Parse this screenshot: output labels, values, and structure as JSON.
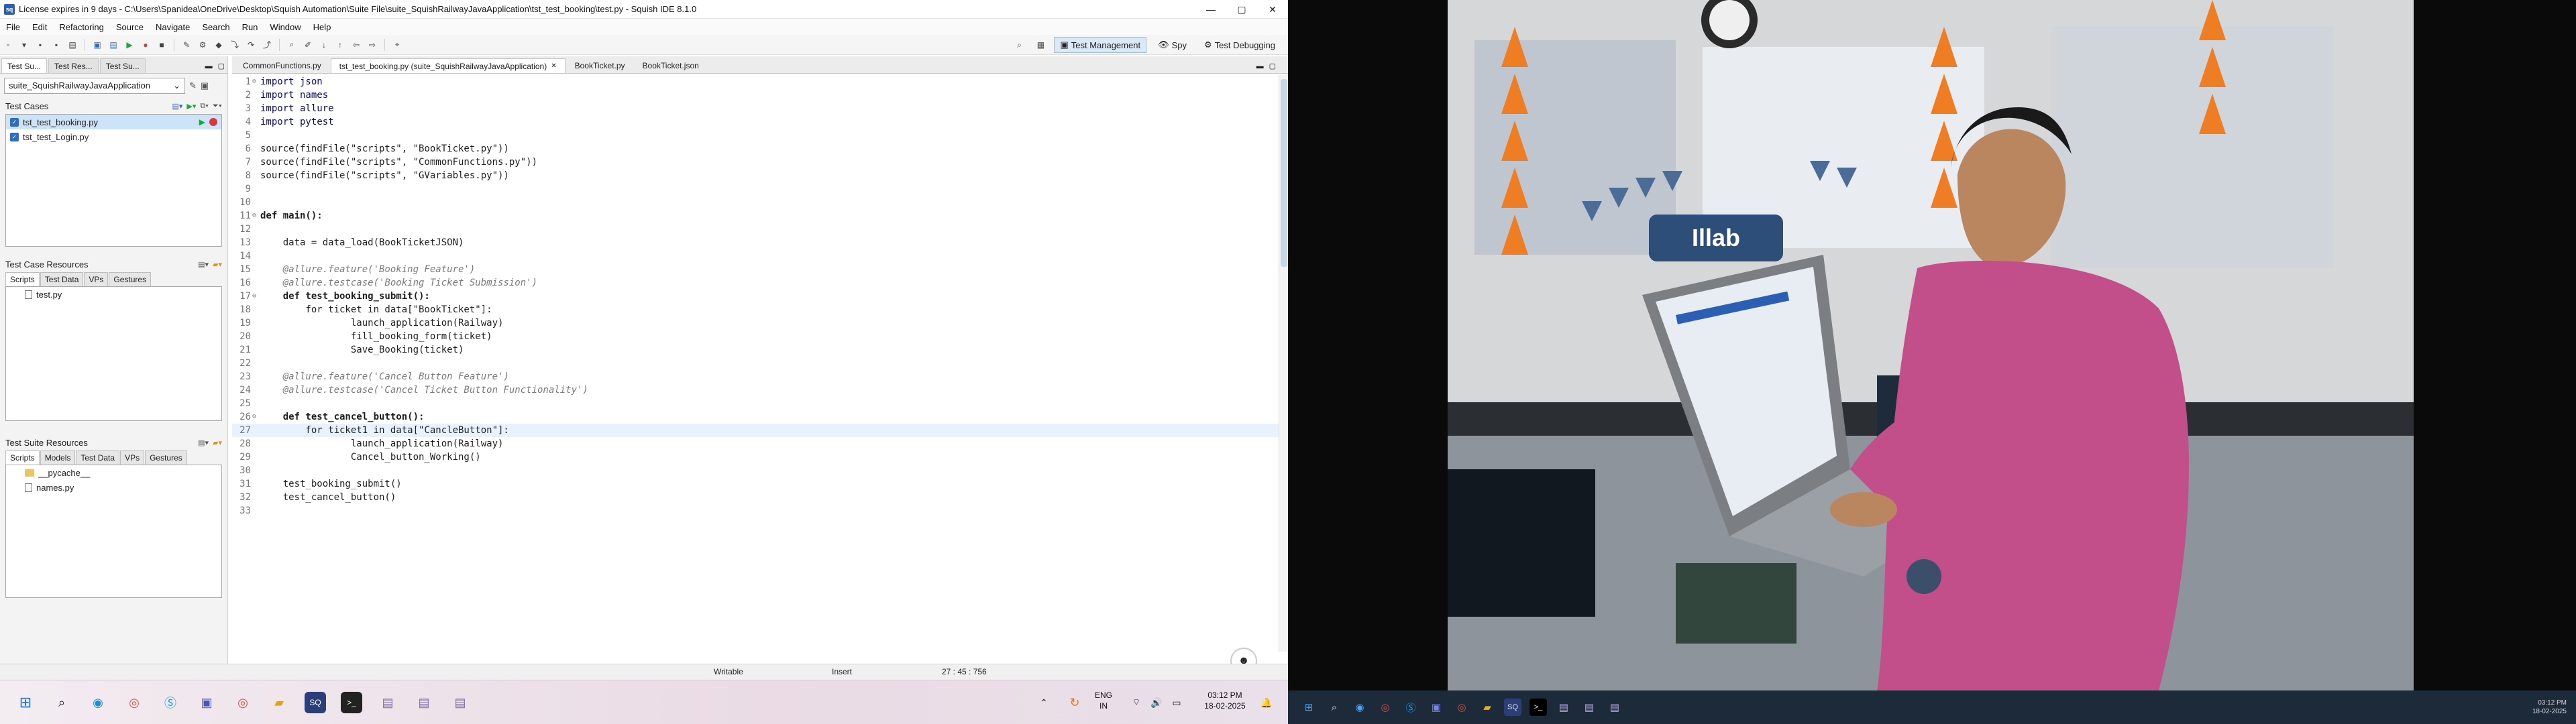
{
  "window": {
    "title": "License expires in 9 days - C:\\Users\\Spanidea\\OneDrive\\Desktop\\Squish Automation\\Suite File\\suite_SquishRailwayJavaApplication\\tst_test_booking\\test.py - Squish IDE 8.1.0",
    "app_icon_text": "sq",
    "controls": {
      "minimize": "—",
      "maximize": "▢",
      "close": "✕"
    }
  },
  "menu": [
    "File",
    "Edit",
    "Refactoring",
    "Source",
    "Navigate",
    "Search",
    "Run",
    "Window",
    "Help"
  ],
  "perspectives": [
    {
      "label": "Test Management",
      "icon": "▣",
      "active": true
    },
    {
      "label": "Spy",
      "icon": "👁",
      "active": false
    },
    {
      "label": "Test Debugging",
      "icon": "⚙",
      "active": false
    }
  ],
  "left_tabs": [
    "Test Su...",
    "Test Res...",
    "Test Su..."
  ],
  "suite_selector": "suite_SquishRailwayJavaApplication",
  "test_cases": {
    "title": "Test Cases",
    "items": [
      {
        "name": "tst_test_booking.py",
        "selected": true
      },
      {
        "name": "tst_test_Login.py",
        "selected": false
      }
    ]
  },
  "test_case_resources": {
    "title": "Test Case Resources",
    "tabs": [
      "Scripts",
      "Test Data",
      "VPs",
      "Gestures"
    ],
    "files": [
      "test.py"
    ]
  },
  "test_suite_resources": {
    "title": "Test Suite Resources",
    "tabs": [
      "Scripts",
      "Models",
      "Test Data",
      "VPs",
      "Gestures"
    ],
    "files": [
      {
        "name": "__pycache__",
        "type": "folder"
      },
      {
        "name": "names.py",
        "type": "file"
      }
    ]
  },
  "editor_tabs": [
    {
      "label": "CommonFunctions.py",
      "active": false
    },
    {
      "label": "tst_test_booking.py (suite_SquishRailwayJavaApplication)",
      "active": true
    },
    {
      "label": "BookTicket.py",
      "active": false
    },
    {
      "label": "BookTicket.json",
      "active": false
    }
  ],
  "code_lines": [
    {
      "n": "1",
      "fold": "⊖",
      "text": "import json"
    },
    {
      "n": "2",
      "fold": "",
      "text": "import names"
    },
    {
      "n": "3",
      "fold": "",
      "text": "import allure"
    },
    {
      "n": "4",
      "fold": "",
      "text": "import pytest"
    },
    {
      "n": "5",
      "fold": "",
      "text": ""
    },
    {
      "n": "6",
      "fold": "",
      "text": "source(findFile(\"scripts\", \"BookTicket.py\"))"
    },
    {
      "n": "7",
      "fold": "",
      "text": "source(findFile(\"scripts\", \"CommonFunctions.py\"))"
    },
    {
      "n": "8",
      "fold": "",
      "text": "source(findFile(\"scripts\", \"GVariables.py\"))"
    },
    {
      "n": "9",
      "fold": "",
      "text": ""
    },
    {
      "n": "10",
      "fold": "",
      "text": ""
    },
    {
      "n": "11",
      "fold": "⊖",
      "text": "def main():"
    },
    {
      "n": "12",
      "fold": "",
      "text": ""
    },
    {
      "n": "13",
      "fold": "",
      "text": "    data = data_load(BookTicketJSON)"
    },
    {
      "n": "14",
      "fold": "",
      "text": ""
    },
    {
      "n": "15",
      "fold": "",
      "text": "    @allure.feature('Booking Feature')"
    },
    {
      "n": "16",
      "fold": "",
      "text": "    @allure.testcase('Booking Ticket Submission')"
    },
    {
      "n": "17",
      "fold": "⊖",
      "text": "    def test_booking_submit():"
    },
    {
      "n": "18",
      "fold": "",
      "text": "        for ticket in data[\"BookTicket\"]:"
    },
    {
      "n": "19",
      "fold": "",
      "text": "                launch_application(Railway)"
    },
    {
      "n": "20",
      "fold": "",
      "text": "                fill_booking_form(ticket)"
    },
    {
      "n": "21",
      "fold": "",
      "text": "                Save_Booking(ticket)"
    },
    {
      "n": "22",
      "fold": "",
      "text": ""
    },
    {
      "n": "23",
      "fold": "",
      "text": "    @allure.feature('Cancel Button Feature')"
    },
    {
      "n": "24",
      "fold": "",
      "text": "    @allure.testcase('Cancel Ticket Button Functionality')"
    },
    {
      "n": "25",
      "fold": "",
      "text": ""
    },
    {
      "n": "26",
      "fold": "⊖",
      "text": "    def test_cancel_button():"
    },
    {
      "n": "27",
      "fold": "",
      "text": "        for ticket1 in data[\"CancleButton\"]:"
    },
    {
      "n": "28",
      "fold": "",
      "text": "                launch_application(Railway)"
    },
    {
      "n": "29",
      "fold": "",
      "text": "                Cancel_button_Working()"
    },
    {
      "n": "30",
      "fold": "",
      "text": ""
    },
    {
      "n": "31",
      "fold": "",
      "text": "    test_booking_submit()"
    },
    {
      "n": "32",
      "fold": "",
      "text": "    test_cancel_button()"
    },
    {
      "n": "33",
      "fold": "",
      "text": ""
    }
  ],
  "current_line": "27",
  "status": {
    "mode": "Writable",
    "insert": "Insert",
    "position": "27 : 45 : 756"
  },
  "tray": {
    "lang": "ENG",
    "region": "IN",
    "time": "03:12 PM",
    "date": "18-02-2025"
  },
  "tray2": {
    "time": "03:12 PM",
    "date": "18-02-2025"
  },
  "photo": {
    "sign_text": "Illab"
  },
  "colors": {
    "accent": "#2d6cc7",
    "selection": "#cde3f7",
    "taskbar": "#eadbe4",
    "taskbar2": "#1c2a3a"
  }
}
